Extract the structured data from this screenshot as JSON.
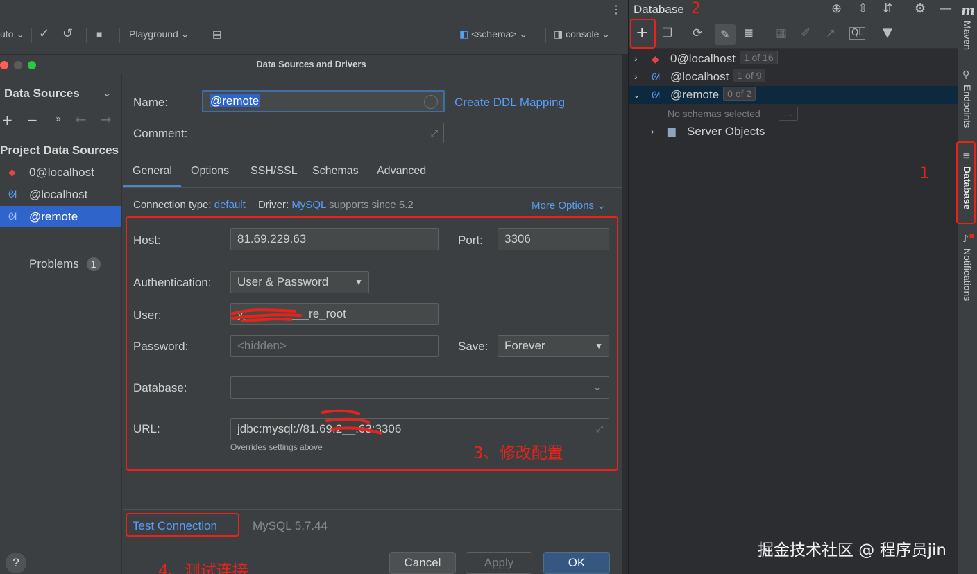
{
  "toolbar": {
    "auto_label": "uto",
    "playground_label": "Playground",
    "schema_label": "<schema>",
    "console_label": "console"
  },
  "dialog": {
    "title": "Data Sources and Drivers",
    "left": {
      "header": "Data Sources",
      "section": "Project Data Sources",
      "items": [
        "0@localhost",
        "@localhost",
        "@remote"
      ],
      "problems_label": "Problems",
      "problems_count": "1"
    },
    "name_label": "Name:",
    "name_value": "@remote",
    "create_ddl": "Create DDL Mapping",
    "comment_label": "Comment:",
    "tabs": [
      "General",
      "Options",
      "SSH/SSL",
      "Schemas",
      "Advanced"
    ],
    "conn_type_label": "Connection type:",
    "conn_type_value": "default",
    "driver_label": "Driver:",
    "driver_value": "MySQL",
    "driver_suffix": "supports since 5.2",
    "more_options": "More Options",
    "host_label": "Host:",
    "host_value": "81.69.229.63",
    "port_label": "Port:",
    "port_value": "3306",
    "auth_label": "Authentication:",
    "auth_value": "User & Password",
    "user_label": "User:",
    "user_value": "y__________re_root",
    "password_label": "Password:",
    "password_placeholder": "<hidden>",
    "save_label": "Save:",
    "save_value": "Forever",
    "database_label": "Database:",
    "url_label": "URL:",
    "url_value": "jdbc:mysql://81.69.2__.63:3306",
    "url_note": "Overrides settings above",
    "test_connection": "Test Connection",
    "mysql_version": "MySQL 5.7.44",
    "help": "?",
    "cancel": "Cancel",
    "apply": "Apply",
    "ok": "OK"
  },
  "annotations": {
    "step1": "1",
    "step2": "2",
    "step3": "3、修改配置",
    "step4": "4、测试连接"
  },
  "db_panel": {
    "title": "Database",
    "tree": [
      {
        "name": "0@localhost",
        "badge": "1 of 16"
      },
      {
        "name": "@localhost",
        "badge": "1 of 9"
      },
      {
        "name": "@remote",
        "badge": "0 of 2"
      }
    ],
    "no_schemas": "No schemas selected",
    "no_schemas_btn": "...",
    "server_objects": "Server Objects"
  },
  "side_strip": {
    "maven_logo": "m",
    "maven": "Maven",
    "endpoints": "Endpoints",
    "database": "Database",
    "notifications": "Notifications"
  },
  "watermark": "掘金技术社区 @ 程序员jin",
  "colors": {
    "accent_blue": "#589df6",
    "selection_blue": "#2f65ca",
    "annotation_red": "#e8231a",
    "tree_selection": "#0d293e"
  }
}
